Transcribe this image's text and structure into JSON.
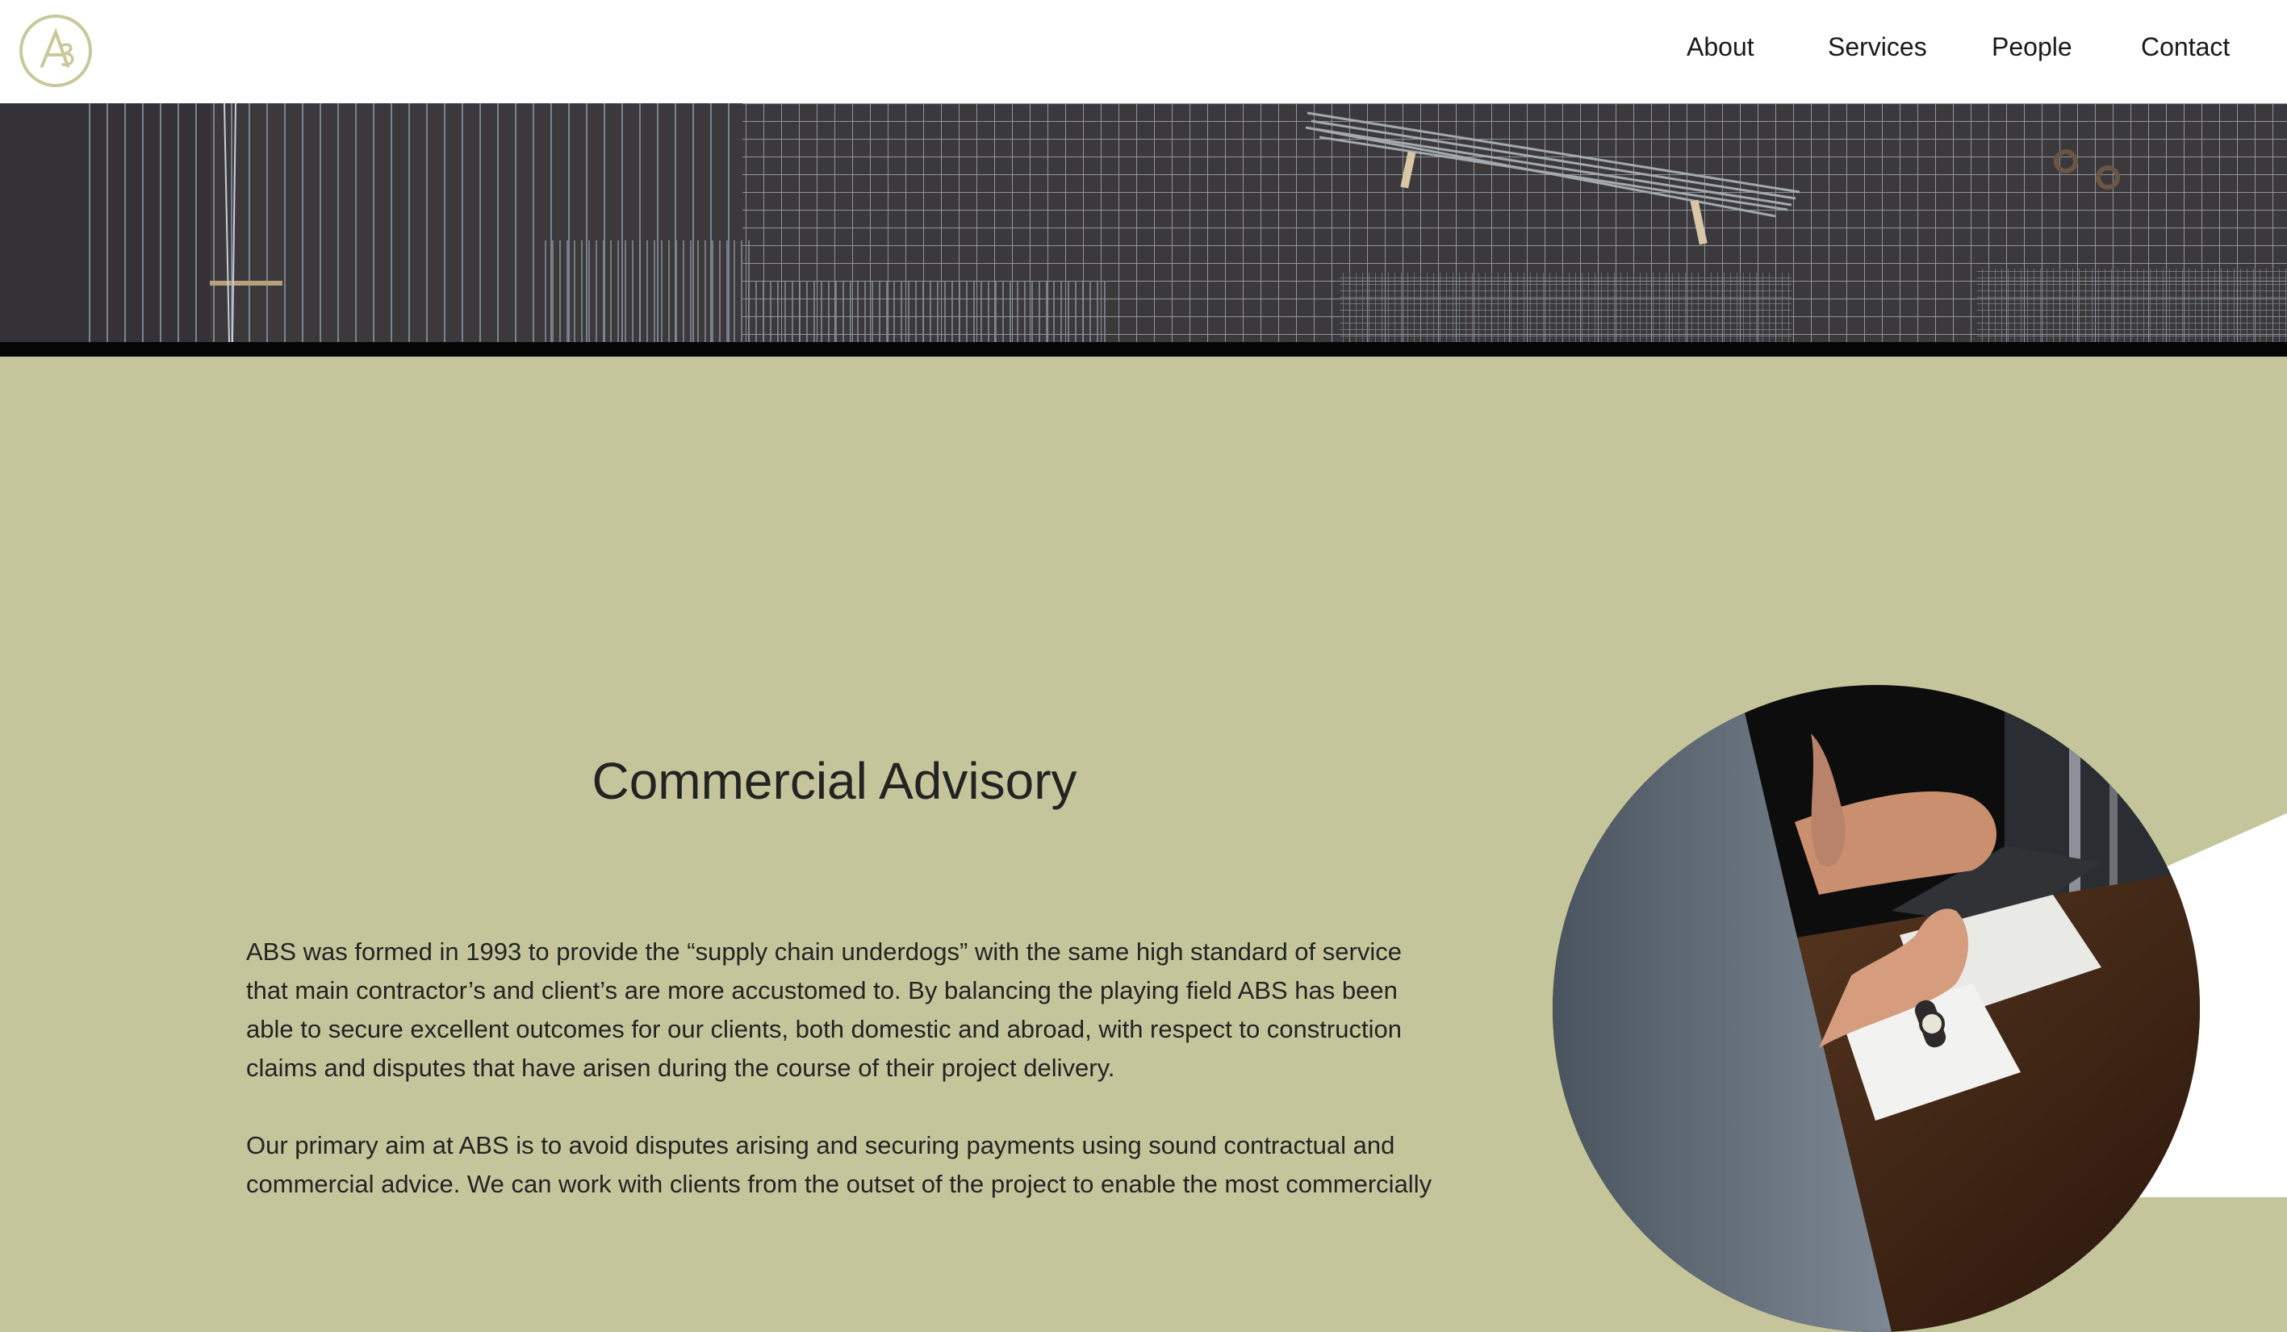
{
  "header": {
    "logo_label": "ABS",
    "nav": [
      {
        "label": "About"
      },
      {
        "label": "Services"
      },
      {
        "label": "People"
      },
      {
        "label": "Contact"
      }
    ]
  },
  "hero": {
    "icon": "wire-mesh-photo"
  },
  "main": {
    "title": "Commercial Advisory",
    "paragraphs": [
      "ABS was formed in 1993 to provide the “supply chain underdogs” with the same high standard of service that main contractor’s and client’s are more accustomed to. By balancing the playing field ABS has been able to secure excellent outcomes for our clients, both domestic and abroad, with respect to construction claims and disputes that have arisen during the course of their project delivery.",
      "Our primary aim at ABS is to avoid disputes arising and securing payments using sound contractual and commercial advice. We can work with clients from the outset of the project to enable the most commercially"
    ],
    "photo_icon": "meeting-photo"
  },
  "colors": {
    "background": "#c5c59c",
    "header": "#ffffff",
    "logo": "#c9c89a",
    "text": "#232323"
  }
}
